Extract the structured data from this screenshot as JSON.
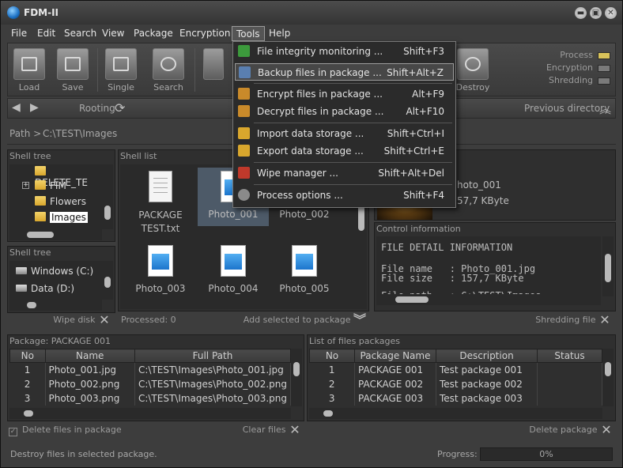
{
  "window": {
    "title": "FDM-II",
    "minimize": "▬",
    "maximize": "▣",
    "close": "✕"
  },
  "menubar": [
    "File",
    "Edit",
    "Search",
    "View",
    "Package",
    "Encryption",
    "Tools",
    "Help"
  ],
  "toolbar": {
    "buttons": [
      "Load",
      "Save",
      "Single",
      "Search"
    ],
    "destroy": "Destroy",
    "indicators": [
      {
        "label": "Process",
        "color": "#d8c25a"
      },
      {
        "label": "Encryption",
        "color": "#7a7a7a"
      },
      {
        "label": "Shredding",
        "color": "#7a7a7a"
      }
    ]
  },
  "nav": {
    "rooting": "Rooting",
    "previous_directory": "Previous directory"
  },
  "path": {
    "label": "Path >",
    "value": "C:\\TEST\\Images"
  },
  "shell_tree": {
    "title": "Shell tree",
    "items": [
      "DELETE_TE",
      "FIM",
      "Flowers",
      "Images"
    ]
  },
  "drive_tree": {
    "title": "Shell tree",
    "items": [
      "Windows (C:)",
      "Data (D:)"
    ],
    "footer": "Wipe disk"
  },
  "shell_list": {
    "title": "Shell list",
    "files": [
      "PACKAGE TEST.txt",
      "Photo_001",
      "Photo_002",
      "Photo_003",
      "Photo_004",
      "Photo_005"
    ],
    "processed": "Processed: 0",
    "add_to_package": "Add selected to package"
  },
  "preview": {
    "name": "hoto_001",
    "size": "57,7 KByte"
  },
  "control": {
    "title": "Control information",
    "heading": "FILE DETAIL INFORMATION",
    "lines": [
      "File name   : Photo_001.jpg",
      "File size   : 157,7 KByte",
      "File path   : C:\\TEST\\Images"
    ],
    "footer": "Shredding file"
  },
  "package": {
    "title": "Package: PACKAGE 001",
    "columns": [
      "No",
      "Name",
      "Full Path"
    ],
    "rows": [
      [
        "1",
        "Photo_001.jpg",
        "C:\\TEST\\Images\\Photo_001.jpg"
      ],
      [
        "2",
        "Photo_002.png",
        "C:\\TEST\\Images\\Photo_002.png"
      ],
      [
        "3",
        "Photo_003.png",
        "C:\\TEST\\Images\\Photo_003.png"
      ]
    ],
    "delete_checkbox": "Delete files in package",
    "clear": "Clear files"
  },
  "packages_list": {
    "title": "List of files packages",
    "columns": [
      "No",
      "Package Name",
      "Description",
      "Status"
    ],
    "rows": [
      [
        "1",
        "PACKAGE 001",
        "Test package 001",
        ""
      ],
      [
        "2",
        "PACKAGE 002",
        "Test package 002",
        ""
      ],
      [
        "3",
        "PACKAGE 003",
        "Test package 003",
        ""
      ]
    ],
    "delete": "Delete package"
  },
  "status": {
    "text": "Destroy files in selected package.",
    "progress_label": "Progress:",
    "progress_value": "0%"
  },
  "tools_menu": [
    {
      "label": "File integrity monitoring ...",
      "shortcut": "Shift+F3",
      "icon": "check-icon",
      "color": "#3c9a3c"
    },
    {
      "label": "Backup files in package ...",
      "shortcut": "Shift+Alt+Z",
      "icon": "backup-icon",
      "color": "#5a7fb0"
    },
    {
      "label": "Encrypt files in package ...",
      "shortcut": "Alt+F9",
      "icon": "lock-icon",
      "color": "#c98a2a"
    },
    {
      "label": "Decrypt files in package ...",
      "shortcut": "Alt+F10",
      "icon": "unlock-icon",
      "color": "#c98a2a"
    },
    {
      "label": "Import data storage ...",
      "shortcut": "Shift+Ctrl+I",
      "icon": "import-icon",
      "color": "#d9a72d"
    },
    {
      "label": "Export data storage ...",
      "shortcut": "Shift+Ctrl+E",
      "icon": "export-icon",
      "color": "#d9a72d"
    },
    {
      "label": "Wipe manager ...",
      "shortcut": "Shift+Alt+Del",
      "icon": "wipe-icon",
      "color": "#c0392b"
    },
    {
      "label": "Process options ...",
      "shortcut": "Shift+F4",
      "icon": "options-icon",
      "color": "#8a8a8a"
    }
  ]
}
